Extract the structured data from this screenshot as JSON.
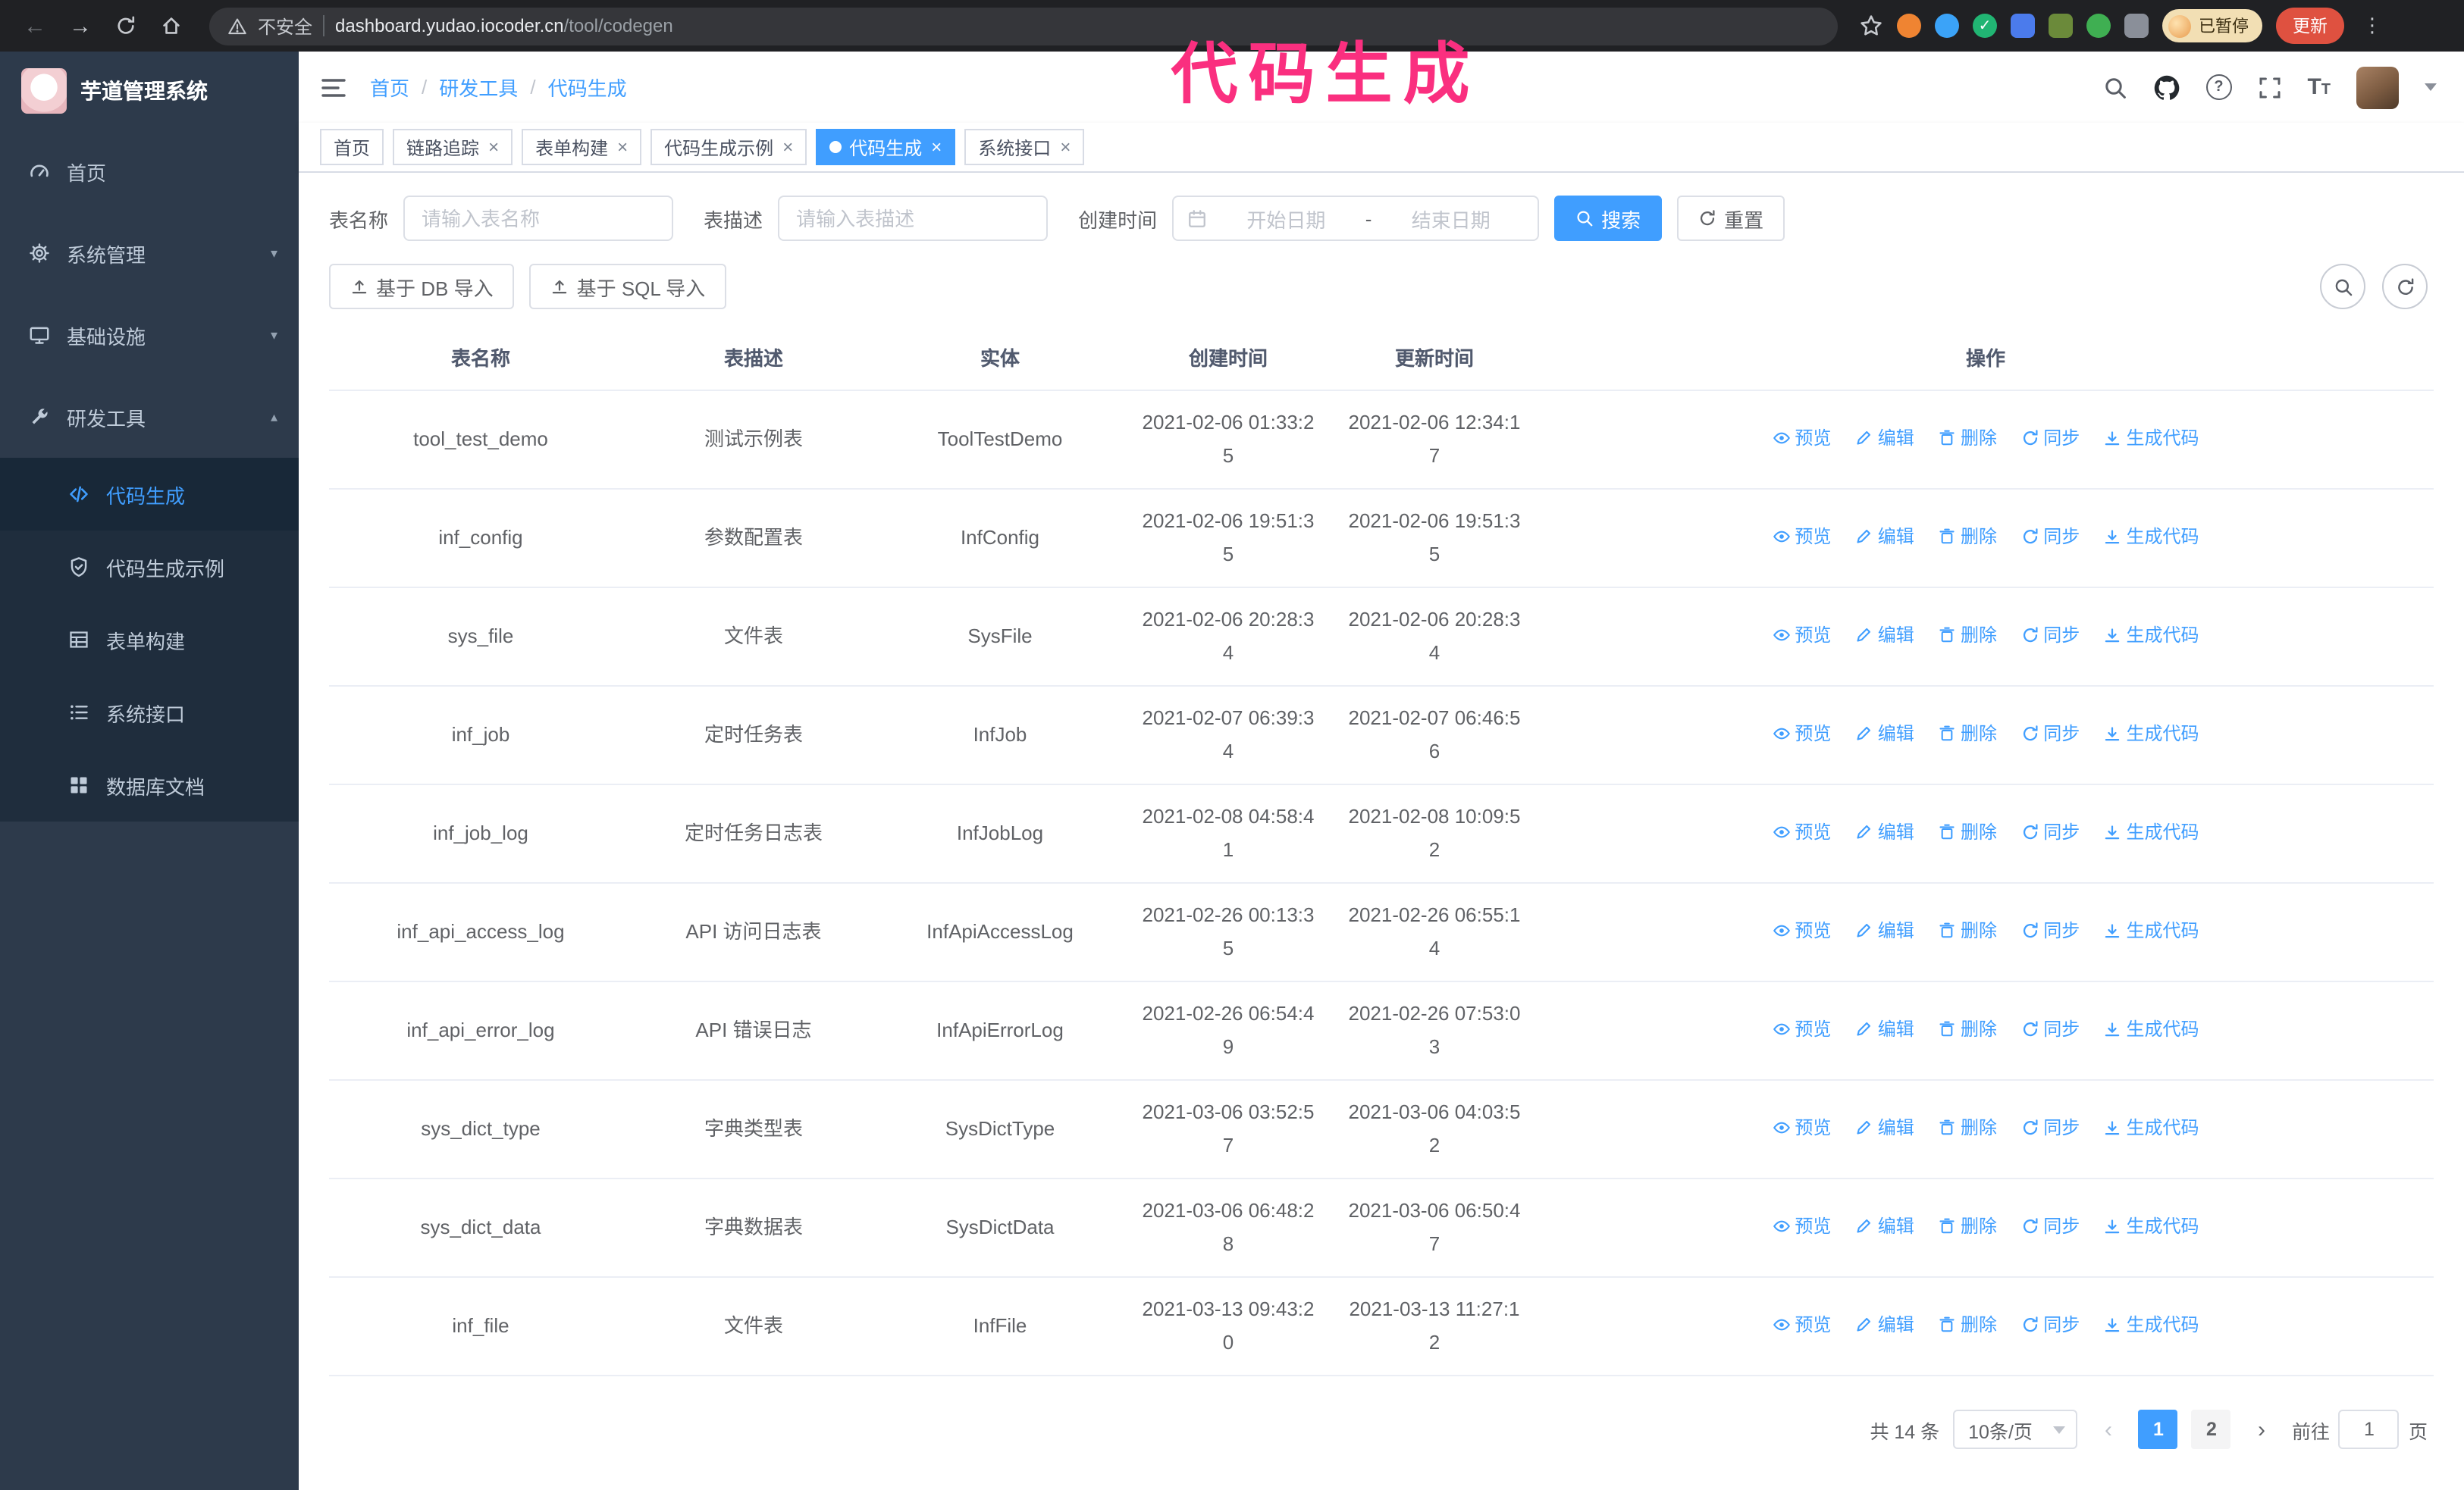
{
  "annotation": {
    "text": "代码生成"
  },
  "browser": {
    "nav_icons": [
      "back-arrow-icon",
      "forward-arrow-icon",
      "refresh-icon",
      "home-icon"
    ],
    "security_label": "不安全",
    "url_host": "dashboard.yudao.iocoder.cn",
    "url_path": "/tool/codegen",
    "paused_badge": "已暂停",
    "update_button": "更新"
  },
  "sidebar": {
    "app_title": "芋道管理系统",
    "items": [
      {
        "label": "首页",
        "icon": "gauge-icon",
        "chevron": ""
      },
      {
        "label": "系统管理",
        "icon": "gear-icon",
        "chevron": "▾"
      },
      {
        "label": "基础设施",
        "icon": "monitor-icon",
        "chevron": "▾"
      },
      {
        "label": "研发工具",
        "icon": "wrench-icon",
        "chevron": "▴"
      }
    ],
    "subitems": [
      {
        "label": "代码生成",
        "icon": "code-icon",
        "active": true
      },
      {
        "label": "代码生成示例",
        "icon": "shield-icon"
      },
      {
        "label": "表单构建",
        "icon": "form-icon"
      },
      {
        "label": "系统接口",
        "icon": "list-icon"
      },
      {
        "label": "数据库文档",
        "icon": "grid-icon"
      }
    ]
  },
  "topbar": {
    "breadcrumb": [
      "首页",
      "研发工具",
      "代码生成"
    ],
    "separator": "/",
    "right_icons": [
      "search-icon",
      "github-icon",
      "question-icon",
      "fullscreen-icon",
      "text-size-icon",
      "avatar",
      "caret-down-icon"
    ]
  },
  "tabs": [
    {
      "label": "首页",
      "closable": false,
      "active": false
    },
    {
      "label": "链路追踪",
      "closable": true,
      "active": false
    },
    {
      "label": "表单构建",
      "closable": true,
      "active": false
    },
    {
      "label": "代码生成示例",
      "closable": true,
      "active": false
    },
    {
      "label": "代码生成",
      "closable": true,
      "active": true
    },
    {
      "label": "系统接口",
      "closable": true,
      "active": false
    }
  ],
  "filters": {
    "table_name_label": "表名称",
    "table_name_placeholder": "请输入表名称",
    "table_desc_label": "表描述",
    "table_desc_placeholder": "请输入表描述",
    "create_time_label": "创建时间",
    "start_date_placeholder": "开始日期",
    "range_separator": "-",
    "end_date_placeholder": "结束日期",
    "search_button": "搜索",
    "reset_button": "重置"
  },
  "toolbar": {
    "import_db": "基于 DB 导入",
    "import_sql": "基于 SQL 导入",
    "mini_icons": [
      "search-icon",
      "refresh-icon"
    ]
  },
  "table": {
    "columns": [
      "表名称",
      "表描述",
      "实体",
      "创建时间",
      "更新时间",
      "操作"
    ],
    "actions": [
      {
        "label": "预览",
        "icon": "eye-icon"
      },
      {
        "label": "编辑",
        "icon": "edit-icon"
      },
      {
        "label": "删除",
        "icon": "delete-icon"
      },
      {
        "label": "同步",
        "icon": "sync-icon"
      },
      {
        "label": "生成代码",
        "icon": "download-icon"
      }
    ],
    "rows": [
      {
        "name": "tool_test_demo",
        "desc": "测试示例表",
        "entity": "ToolTestDemo",
        "created": "2021-02-06 01:33:25",
        "updated": "2021-02-06 12:34:17"
      },
      {
        "name": "inf_config",
        "desc": "参数配置表",
        "entity": "InfConfig",
        "created": "2021-02-06 19:51:35",
        "updated": "2021-02-06 19:51:35"
      },
      {
        "name": "sys_file",
        "desc": "文件表",
        "entity": "SysFile",
        "created": "2021-02-06 20:28:34",
        "updated": "2021-02-06 20:28:34"
      },
      {
        "name": "inf_job",
        "desc": "定时任务表",
        "entity": "InfJob",
        "created": "2021-02-07 06:39:34",
        "updated": "2021-02-07 06:46:56"
      },
      {
        "name": "inf_job_log",
        "desc": "定时任务日志表",
        "entity": "InfJobLog",
        "created": "2021-02-08 04:58:41",
        "updated": "2021-02-08 10:09:52"
      },
      {
        "name": "inf_api_access_log",
        "desc": "API 访问日志表",
        "entity": "InfApiAccessLog",
        "created": "2021-02-26 00:13:35",
        "updated": "2021-02-26 06:55:14"
      },
      {
        "name": "inf_api_error_log",
        "desc": "API 错误日志",
        "entity": "InfApiErrorLog",
        "created": "2021-02-26 06:54:49",
        "updated": "2021-02-26 07:53:03"
      },
      {
        "name": "sys_dict_type",
        "desc": "字典类型表",
        "entity": "SysDictType",
        "created": "2021-03-06 03:52:57",
        "updated": "2021-03-06 04:03:52"
      },
      {
        "name": "sys_dict_data",
        "desc": "字典数据表",
        "entity": "SysDictData",
        "created": "2021-03-06 06:48:28",
        "updated": "2021-03-06 06:50:47"
      },
      {
        "name": "inf_file",
        "desc": "文件表",
        "entity": "InfFile",
        "created": "2021-03-13 09:43:20",
        "updated": "2021-03-13 11:27:12"
      }
    ]
  },
  "pagination": {
    "total": "共 14 条",
    "page_size": "10条/页",
    "prev_icon": "‹",
    "next_icon": "›",
    "pages": [
      "1",
      "2"
    ],
    "active_page": "1",
    "goto_label": "前往",
    "goto_value": "1",
    "page_unit": "页"
  },
  "colors": {
    "accent": "#409eff",
    "sidebar_bg": "#2d3a4b",
    "submenu_bg": "#1f2d3d",
    "chrome_bg": "#202124",
    "update_button": "#df5140",
    "annotation": "#fa2f7f"
  }
}
